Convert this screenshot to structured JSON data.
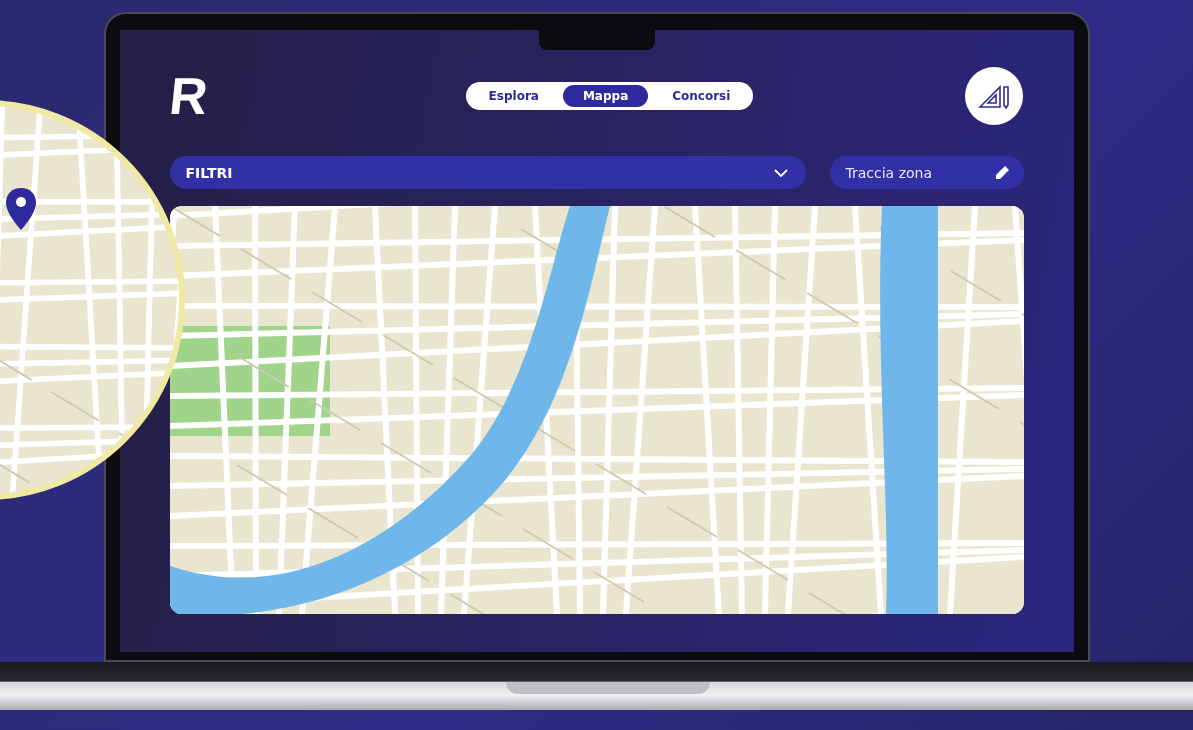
{
  "logo": "R",
  "tabs": [
    {
      "label": "Esplora",
      "selected": false
    },
    {
      "label": "Mappa",
      "selected": true
    },
    {
      "label": "Concorsi",
      "selected": false
    }
  ],
  "filter": {
    "label": "FILTRI"
  },
  "draw_zone": {
    "label": "Traccia zona"
  }
}
